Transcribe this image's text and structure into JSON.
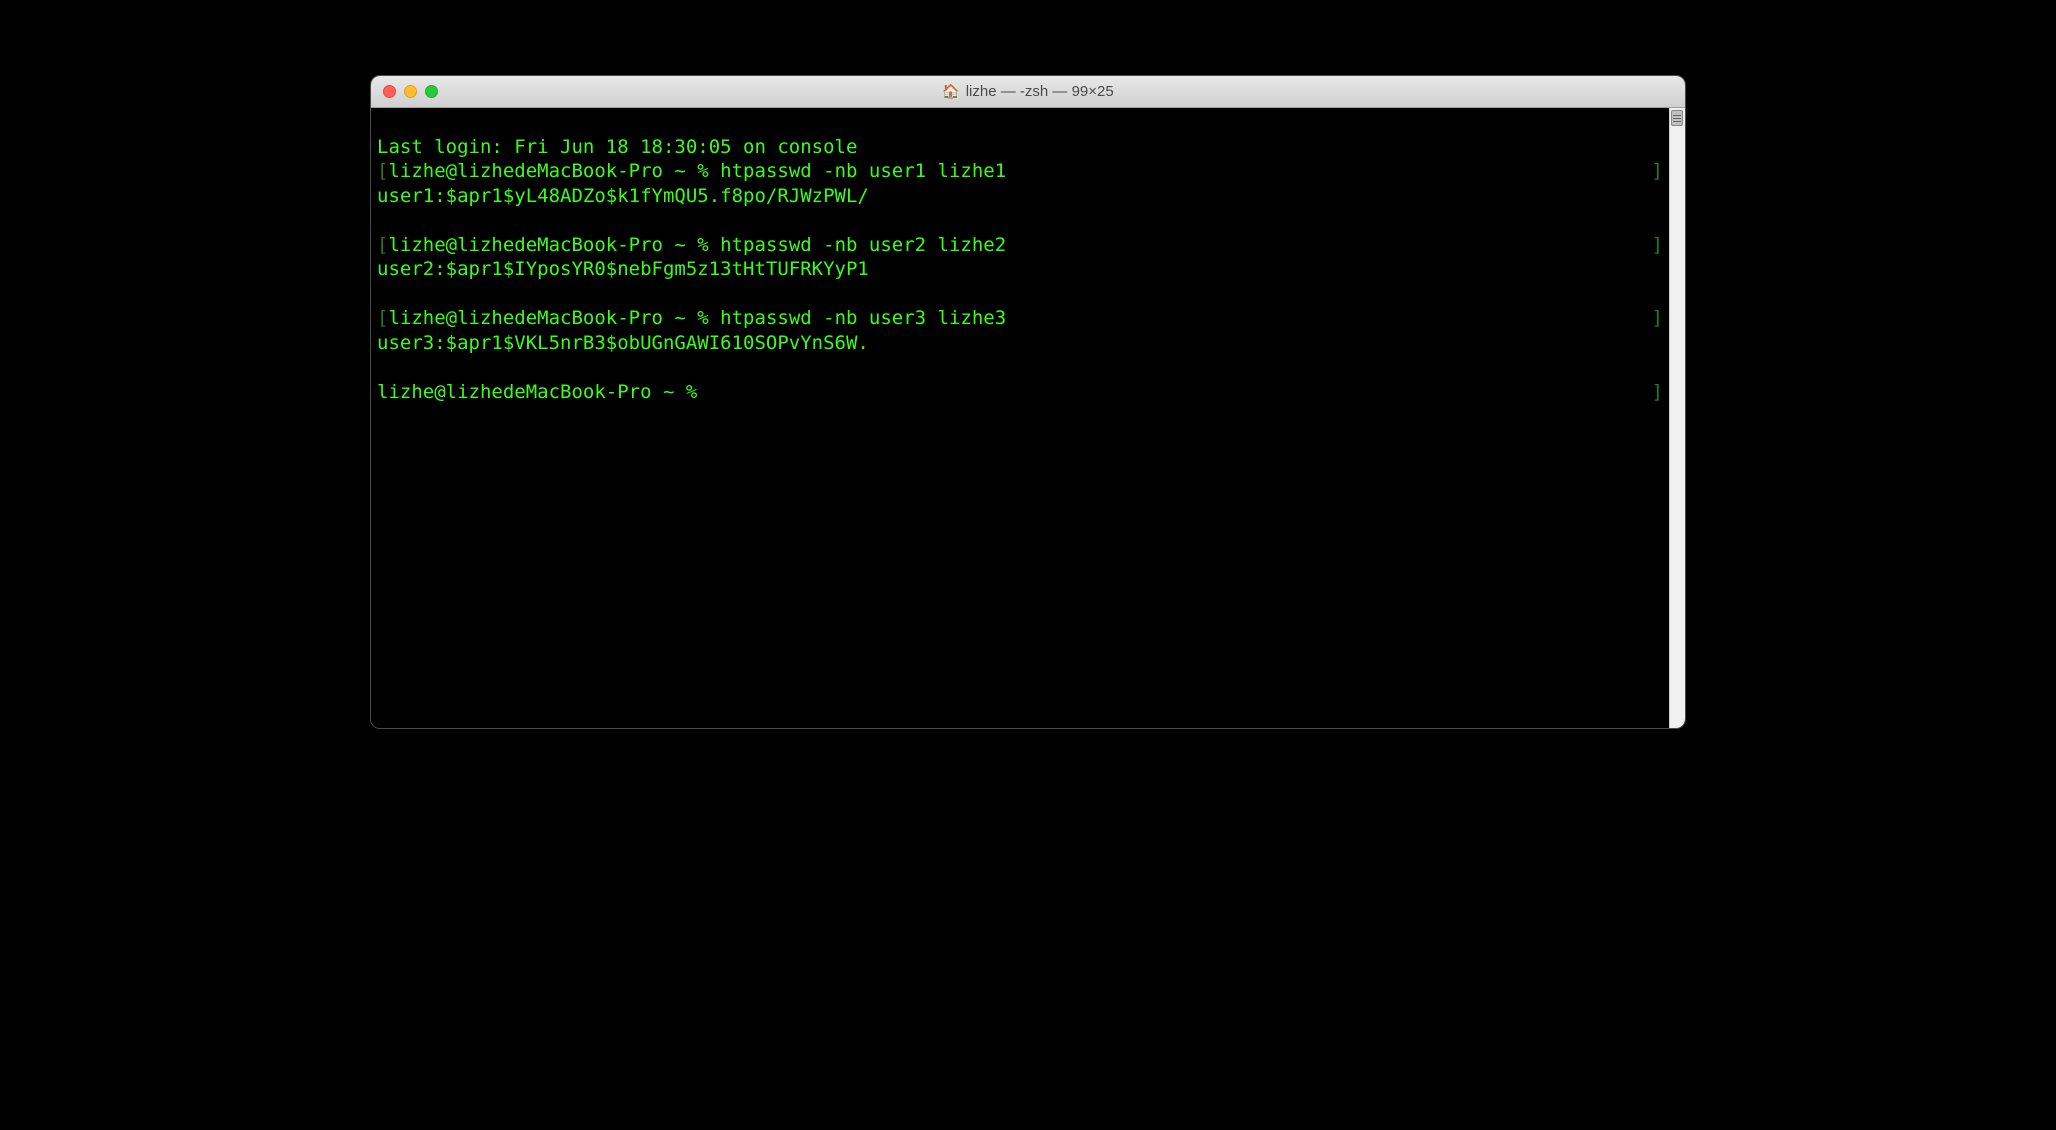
{
  "window": {
    "title": "lizhe — -zsh — 99×25",
    "icon": "home-icon"
  },
  "terminal": {
    "last_login": "Last login: Fri Jun 18 18:30:05 on console",
    "blocks": [
      {
        "lbracket": "[",
        "prompt_cmd": "lizhe@lizhedeMacBook-Pro ~ % htpasswd -nb user1 lizhe1",
        "rbracket": "]",
        "output": "user1:$apr1$yL48ADZo$k1fYmQU5.f8po/RJWzPWL/"
      },
      {
        "lbracket": "[",
        "prompt_cmd": "lizhe@lizhedeMacBook-Pro ~ % htpasswd -nb user2 lizhe2",
        "rbracket": "]",
        "output": "user2:$apr1$IYposYR0$nebFgm5z13tHtTUFRKYyP1"
      },
      {
        "lbracket": "[",
        "prompt_cmd": "lizhe@lizhedeMacBook-Pro ~ % htpasswd -nb user3 lizhe3",
        "rbracket": "]",
        "output": "user3:$apr1$VKL5nrB3$obUGnGAWI610SOPvYnS6W."
      }
    ],
    "final_prompt_left": "lizhe@lizhedeMacBook-Pro ~ % ",
    "final_prompt_right": "]"
  },
  "colors": {
    "bg": "#000000",
    "fg": "#39ff14",
    "dim": "#2d7a0f"
  }
}
